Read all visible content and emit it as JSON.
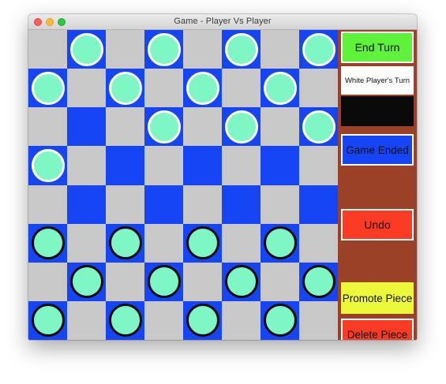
{
  "window": {
    "title": "Game - Player Vs Player"
  },
  "board": {
    "rows": 8,
    "cols": 8,
    "colors": {
      "light": "#c9c9c9",
      "dark": "#1545f5",
      "piece_fill": "#7ff7c5",
      "white_ring": "#ffffff",
      "black_ring": "#0b0b0b"
    },
    "white_pieces": [
      [
        0,
        1
      ],
      [
        0,
        3
      ],
      [
        0,
        5
      ],
      [
        0,
        7
      ],
      [
        1,
        0
      ],
      [
        1,
        2
      ],
      [
        1,
        4
      ],
      [
        1,
        6
      ],
      [
        2,
        3
      ],
      [
        2,
        5
      ],
      [
        2,
        7
      ],
      [
        3,
        0
      ]
    ],
    "black_pieces": [
      [
        5,
        0
      ],
      [
        5,
        2
      ],
      [
        5,
        4
      ],
      [
        5,
        6
      ],
      [
        6,
        1
      ],
      [
        6,
        3
      ],
      [
        6,
        5
      ],
      [
        6,
        7
      ],
      [
        7,
        0
      ],
      [
        7,
        2
      ],
      [
        7,
        4
      ],
      [
        7,
        6
      ]
    ]
  },
  "sidebar": {
    "end_turn_label": "End Turn",
    "status_text": "White Player's Turn",
    "game_state_label": "Game Ended",
    "undo_label": "Undo",
    "promote_label": "Promote Piece",
    "delete_label": "Delete Piece",
    "colors": {
      "panel": "#9b4128",
      "end_turn": "#5ef23a",
      "game_state": "#1545f5",
      "undo": "#fb3b24",
      "promote": "#ecf83a",
      "delete": "#fb3b24"
    }
  }
}
